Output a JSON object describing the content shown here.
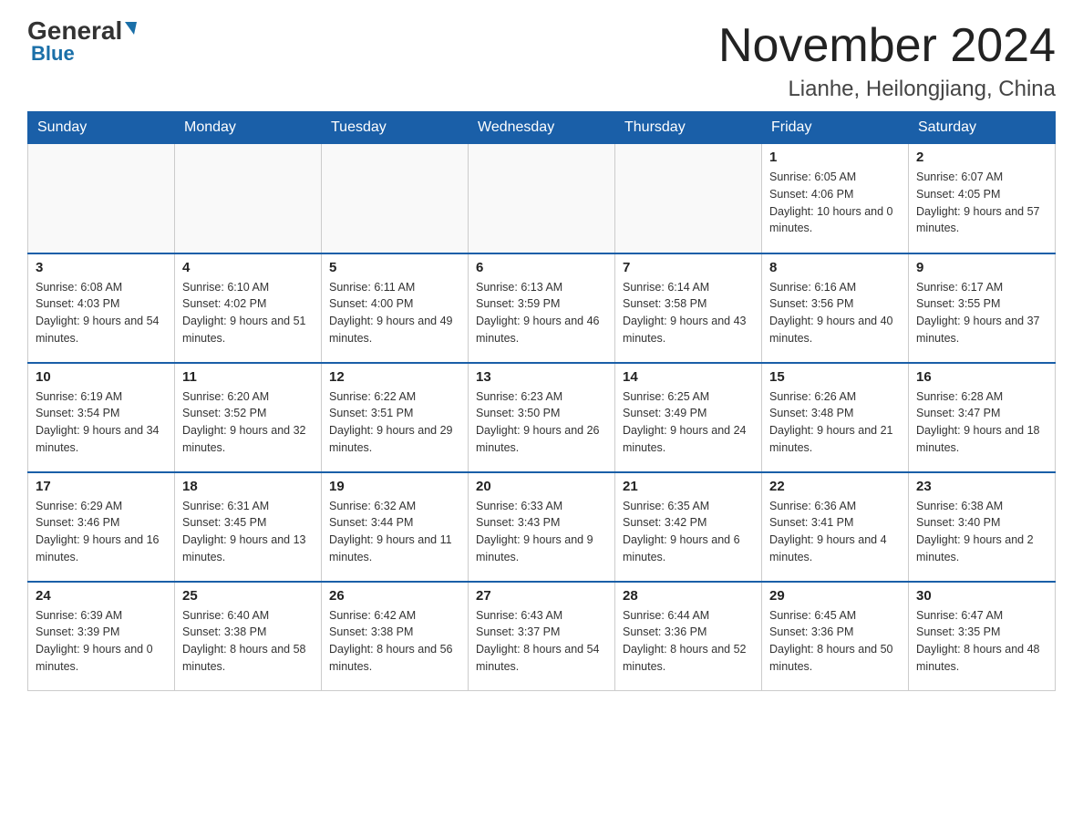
{
  "header": {
    "title": "November 2024",
    "subtitle": "Lianhe, Heilongjiang, China",
    "logo_general": "General",
    "logo_blue": "Blue"
  },
  "weekdays": [
    "Sunday",
    "Monday",
    "Tuesday",
    "Wednesday",
    "Thursday",
    "Friday",
    "Saturday"
  ],
  "weeks": [
    [
      {
        "day": "",
        "info": ""
      },
      {
        "day": "",
        "info": ""
      },
      {
        "day": "",
        "info": ""
      },
      {
        "day": "",
        "info": ""
      },
      {
        "day": "",
        "info": ""
      },
      {
        "day": "1",
        "info": "Sunrise: 6:05 AM\nSunset: 4:06 PM\nDaylight: 10 hours and 0 minutes."
      },
      {
        "day": "2",
        "info": "Sunrise: 6:07 AM\nSunset: 4:05 PM\nDaylight: 9 hours and 57 minutes."
      }
    ],
    [
      {
        "day": "3",
        "info": "Sunrise: 6:08 AM\nSunset: 4:03 PM\nDaylight: 9 hours and 54 minutes."
      },
      {
        "day": "4",
        "info": "Sunrise: 6:10 AM\nSunset: 4:02 PM\nDaylight: 9 hours and 51 minutes."
      },
      {
        "day": "5",
        "info": "Sunrise: 6:11 AM\nSunset: 4:00 PM\nDaylight: 9 hours and 49 minutes."
      },
      {
        "day": "6",
        "info": "Sunrise: 6:13 AM\nSunset: 3:59 PM\nDaylight: 9 hours and 46 minutes."
      },
      {
        "day": "7",
        "info": "Sunrise: 6:14 AM\nSunset: 3:58 PM\nDaylight: 9 hours and 43 minutes."
      },
      {
        "day": "8",
        "info": "Sunrise: 6:16 AM\nSunset: 3:56 PM\nDaylight: 9 hours and 40 minutes."
      },
      {
        "day": "9",
        "info": "Sunrise: 6:17 AM\nSunset: 3:55 PM\nDaylight: 9 hours and 37 minutes."
      }
    ],
    [
      {
        "day": "10",
        "info": "Sunrise: 6:19 AM\nSunset: 3:54 PM\nDaylight: 9 hours and 34 minutes."
      },
      {
        "day": "11",
        "info": "Sunrise: 6:20 AM\nSunset: 3:52 PM\nDaylight: 9 hours and 32 minutes."
      },
      {
        "day": "12",
        "info": "Sunrise: 6:22 AM\nSunset: 3:51 PM\nDaylight: 9 hours and 29 minutes."
      },
      {
        "day": "13",
        "info": "Sunrise: 6:23 AM\nSunset: 3:50 PM\nDaylight: 9 hours and 26 minutes."
      },
      {
        "day": "14",
        "info": "Sunrise: 6:25 AM\nSunset: 3:49 PM\nDaylight: 9 hours and 24 minutes."
      },
      {
        "day": "15",
        "info": "Sunrise: 6:26 AM\nSunset: 3:48 PM\nDaylight: 9 hours and 21 minutes."
      },
      {
        "day": "16",
        "info": "Sunrise: 6:28 AM\nSunset: 3:47 PM\nDaylight: 9 hours and 18 minutes."
      }
    ],
    [
      {
        "day": "17",
        "info": "Sunrise: 6:29 AM\nSunset: 3:46 PM\nDaylight: 9 hours and 16 minutes."
      },
      {
        "day": "18",
        "info": "Sunrise: 6:31 AM\nSunset: 3:45 PM\nDaylight: 9 hours and 13 minutes."
      },
      {
        "day": "19",
        "info": "Sunrise: 6:32 AM\nSunset: 3:44 PM\nDaylight: 9 hours and 11 minutes."
      },
      {
        "day": "20",
        "info": "Sunrise: 6:33 AM\nSunset: 3:43 PM\nDaylight: 9 hours and 9 minutes."
      },
      {
        "day": "21",
        "info": "Sunrise: 6:35 AM\nSunset: 3:42 PM\nDaylight: 9 hours and 6 minutes."
      },
      {
        "day": "22",
        "info": "Sunrise: 6:36 AM\nSunset: 3:41 PM\nDaylight: 9 hours and 4 minutes."
      },
      {
        "day": "23",
        "info": "Sunrise: 6:38 AM\nSunset: 3:40 PM\nDaylight: 9 hours and 2 minutes."
      }
    ],
    [
      {
        "day": "24",
        "info": "Sunrise: 6:39 AM\nSunset: 3:39 PM\nDaylight: 9 hours and 0 minutes."
      },
      {
        "day": "25",
        "info": "Sunrise: 6:40 AM\nSunset: 3:38 PM\nDaylight: 8 hours and 58 minutes."
      },
      {
        "day": "26",
        "info": "Sunrise: 6:42 AM\nSunset: 3:38 PM\nDaylight: 8 hours and 56 minutes."
      },
      {
        "day": "27",
        "info": "Sunrise: 6:43 AM\nSunset: 3:37 PM\nDaylight: 8 hours and 54 minutes."
      },
      {
        "day": "28",
        "info": "Sunrise: 6:44 AM\nSunset: 3:36 PM\nDaylight: 8 hours and 52 minutes."
      },
      {
        "day": "29",
        "info": "Sunrise: 6:45 AM\nSunset: 3:36 PM\nDaylight: 8 hours and 50 minutes."
      },
      {
        "day": "30",
        "info": "Sunrise: 6:47 AM\nSunset: 3:35 PM\nDaylight: 8 hours and 48 minutes."
      }
    ]
  ]
}
